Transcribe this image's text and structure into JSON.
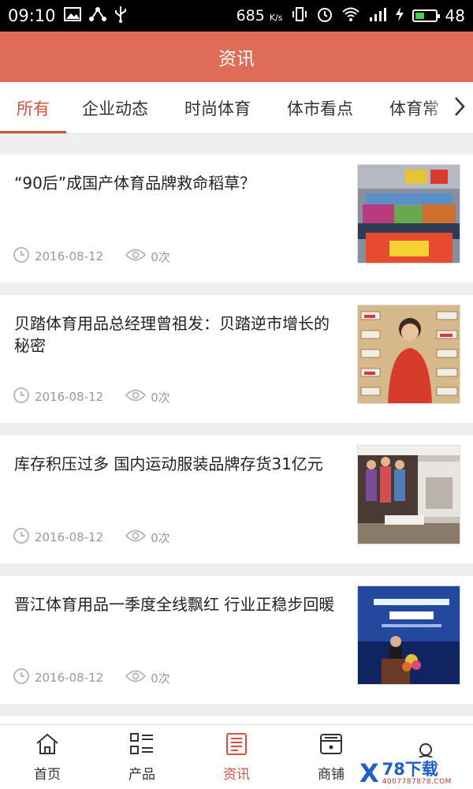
{
  "status_bar": {
    "time": "09:10",
    "net_speed": "685",
    "net_unit": "K/s",
    "battery": "48",
    "battery_level_pct": 48
  },
  "header": {
    "title": "资讯"
  },
  "tabs": {
    "items": [
      {
        "label": "所有",
        "active": true
      },
      {
        "label": "企业动态",
        "active": false
      },
      {
        "label": "时尚体育",
        "active": false
      },
      {
        "label": "体市看点",
        "active": false
      },
      {
        "label": "体育常",
        "active": false
      }
    ],
    "next_icon": "chevron-right-icon"
  },
  "articles": [
    {
      "title": "“90后”成国产体育品牌救命稻草？",
      "date": "2016-08-12",
      "views": "0次"
    },
    {
      "title": "贝踏体育用品总经理曾祖发：贝踏逆市增长的秘密",
      "date": "2016-08-12",
      "views": "0次"
    },
    {
      "title": "库存积压过多 国内运动服装品牌存货31亿元",
      "date": "2016-08-12",
      "views": "0次"
    },
    {
      "title": "晋江体育用品一季度全线飘红 行业正稳步回暖",
      "date": "2016-08-12",
      "views": "0次"
    }
  ],
  "tabbar": {
    "items": [
      {
        "label": "首页",
        "icon": "home-icon",
        "active": false
      },
      {
        "label": "产品",
        "icon": "product-list-icon",
        "active": false
      },
      {
        "label": "资讯",
        "icon": "news-icon",
        "active": true
      },
      {
        "label": "商铺",
        "icon": "store-icon",
        "active": false
      },
      {
        "label": "",
        "icon": "user-icon",
        "active": false
      }
    ]
  },
  "watermark": {
    "mark": "X",
    "title": "78下载",
    "url": "4007787878.COM"
  },
  "colors": {
    "accent": "#df6c56",
    "active_text": "#d9503f",
    "meta": "#999999"
  }
}
